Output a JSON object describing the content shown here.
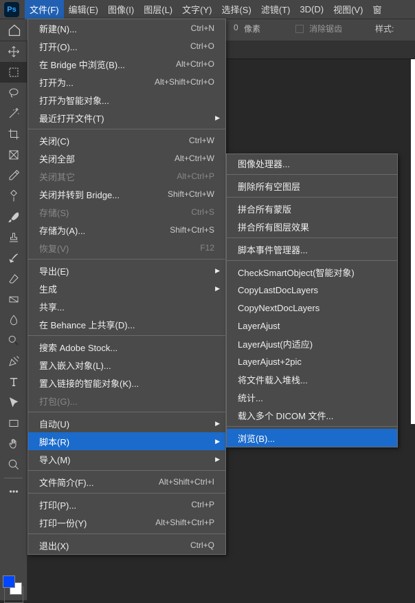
{
  "menubar": {
    "items": [
      "文件(F)",
      "编辑(E)",
      "图像(I)",
      "图层(L)",
      "文字(Y)",
      "选择(S)",
      "滤镜(T)",
      "3D(D)",
      "视图(V)",
      "窗"
    ]
  },
  "options": {
    "pixels": "像素",
    "antialias": "消除锯齿",
    "style": "样式:"
  },
  "file_menu": [
    {
      "label": "新建(N)...",
      "shortcut": "Ctrl+N"
    },
    {
      "label": "打开(O)...",
      "shortcut": "Ctrl+O"
    },
    {
      "label": "在 Bridge 中浏览(B)...",
      "shortcut": "Alt+Ctrl+O"
    },
    {
      "label": "打开为...",
      "shortcut": "Alt+Shift+Ctrl+O"
    },
    {
      "label": "打开为智能对象..."
    },
    {
      "label": "最近打开文件(T)",
      "arrow": true
    },
    {
      "sep": true
    },
    {
      "label": "关闭(C)",
      "shortcut": "Ctrl+W"
    },
    {
      "label": "关闭全部",
      "shortcut": "Alt+Ctrl+W"
    },
    {
      "label": "关闭其它",
      "shortcut": "Alt+Ctrl+P",
      "disabled": true
    },
    {
      "label": "关闭并转到 Bridge...",
      "shortcut": "Shift+Ctrl+W"
    },
    {
      "label": "存储(S)",
      "shortcut": "Ctrl+S",
      "disabled": true
    },
    {
      "label": "存储为(A)...",
      "shortcut": "Shift+Ctrl+S"
    },
    {
      "label": "恢复(V)",
      "shortcut": "F12",
      "disabled": true
    },
    {
      "sep": true
    },
    {
      "label": "导出(E)",
      "arrow": true
    },
    {
      "label": "生成",
      "arrow": true
    },
    {
      "label": "共享..."
    },
    {
      "label": "在 Behance 上共享(D)..."
    },
    {
      "sep": true
    },
    {
      "label": "搜索 Adobe Stock..."
    },
    {
      "label": "置入嵌入对象(L)..."
    },
    {
      "label": "置入链接的智能对象(K)..."
    },
    {
      "label": "打包(G)...",
      "disabled": true
    },
    {
      "sep": true
    },
    {
      "label": "自动(U)",
      "arrow": true
    },
    {
      "label": "脚本(R)",
      "arrow": true,
      "highlighted": true
    },
    {
      "label": "导入(M)",
      "arrow": true
    },
    {
      "sep": true
    },
    {
      "label": "文件简介(F)...",
      "shortcut": "Alt+Shift+Ctrl+I"
    },
    {
      "sep": true
    },
    {
      "label": "打印(P)...",
      "shortcut": "Ctrl+P"
    },
    {
      "label": "打印一份(Y)",
      "shortcut": "Alt+Shift+Ctrl+P"
    },
    {
      "sep": true
    },
    {
      "label": "退出(X)",
      "shortcut": "Ctrl+Q"
    }
  ],
  "scripts_menu": [
    {
      "label": "图像处理器..."
    },
    {
      "sep": true
    },
    {
      "label": "删除所有空图层"
    },
    {
      "sep": true
    },
    {
      "label": "拼合所有蒙版"
    },
    {
      "label": "拼合所有图层效果"
    },
    {
      "sep": true
    },
    {
      "label": "脚本事件管理器..."
    },
    {
      "sep": true
    },
    {
      "label": "CheckSmartObject(智能对象)"
    },
    {
      "label": "CopyLastDocLayers"
    },
    {
      "label": "CopyNextDocLayers"
    },
    {
      "label": "LayerAjust"
    },
    {
      "label": "LayerAjust(内适应)"
    },
    {
      "label": "LayerAjust+2pic"
    },
    {
      "label": "将文件载入堆栈..."
    },
    {
      "label": "统计..."
    },
    {
      "label": "载入多个 DICOM 文件..."
    },
    {
      "sep": true
    },
    {
      "label": "浏览(B)...",
      "highlighted": true
    }
  ],
  "zero": "0"
}
